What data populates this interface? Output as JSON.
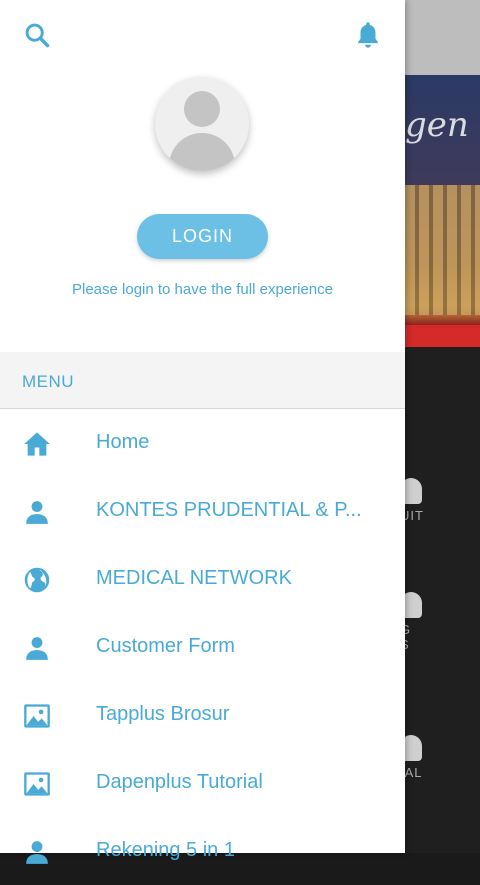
{
  "background_app": {
    "banner_text": "gen",
    "tile_labels": [
      "UIT",
      "G\nS",
      "IAL"
    ]
  },
  "drawer": {
    "login_button": "LOGIN",
    "login_hint": "Please login to have the full experience",
    "menu_title": "MENU",
    "items": [
      {
        "label": "Home",
        "icon": "home-icon"
      },
      {
        "label": "KONTES PRUDENTIAL & P...",
        "icon": "person-icon"
      },
      {
        "label": "MEDICAL NETWORK",
        "icon": "globe-icon"
      },
      {
        "label": "Customer Form",
        "icon": "person-icon"
      },
      {
        "label": "Tapplus Brosur",
        "icon": "image-icon"
      },
      {
        "label": "Dapenplus Tutorial",
        "icon": "image-icon"
      },
      {
        "label": "Rekening 5 in 1",
        "icon": "person-icon"
      }
    ]
  },
  "colors": {
    "accent": "#4aaad6",
    "button": "#6cc0e6",
    "menu_header_bg": "#f4f4f4"
  }
}
